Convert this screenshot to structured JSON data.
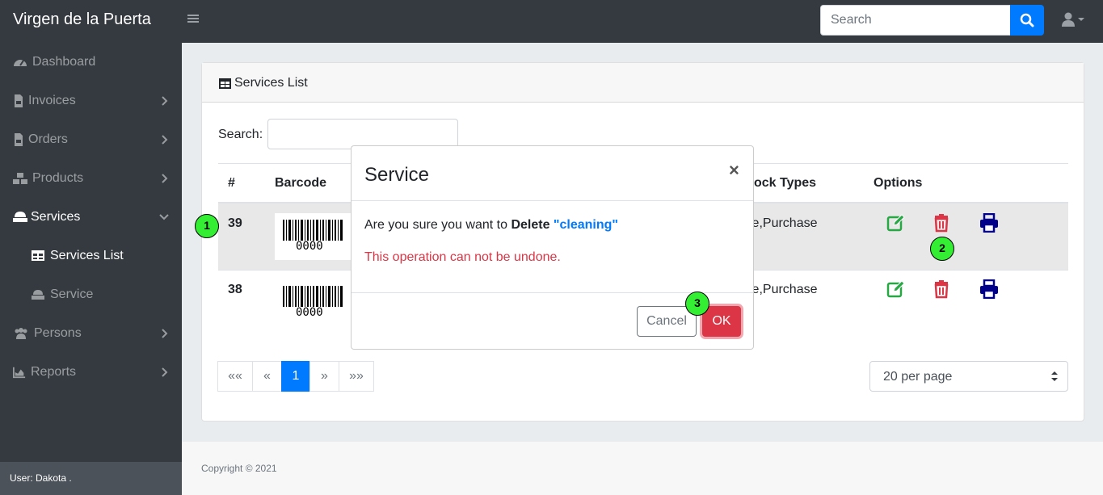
{
  "app": {
    "title": "Virgen de la Puerta"
  },
  "topbar": {
    "search_placeholder": "Search"
  },
  "sidebar": {
    "items": [
      {
        "label": "Dashboard"
      },
      {
        "label": "Invoices"
      },
      {
        "label": "Orders"
      },
      {
        "label": "Products"
      },
      {
        "label": "Services"
      },
      {
        "label": "Services List"
      },
      {
        "label": "Service"
      },
      {
        "label": "Persons"
      },
      {
        "label": "Reports"
      }
    ],
    "footer": "User: Dakota ."
  },
  "card": {
    "title": "Services List",
    "search_label": "Search:",
    "columns": [
      "#",
      "Barcode",
      "ock Types",
      "Options"
    ],
    "rows": [
      {
        "id": "39",
        "barcode": "0000",
        "types": "le,Purchase"
      },
      {
        "id": "38",
        "barcode": "0000",
        "types": "le,Purchase"
      }
    ],
    "pagination": [
      "««",
      "«",
      "1",
      "»",
      "»»"
    ],
    "per_page": "20 per page"
  },
  "footer": {
    "copyright": "Copyright © 2021"
  },
  "modal": {
    "title": "Service",
    "close": "×",
    "question_prefix": "Are you sure you want to",
    "question_action": "Delete",
    "question_name": "\"cleaning\"",
    "warning": "This operation can not be undone.",
    "cancel_label": "Cancel",
    "ok_label": "OK"
  },
  "markers": [
    "1",
    "2",
    "3"
  ],
  "colors": {
    "sidebar": "#343a40",
    "primary": "#007bff",
    "danger": "#dc3545",
    "success": "#28a745",
    "print": "#00008b",
    "marker": "#33ee33"
  }
}
